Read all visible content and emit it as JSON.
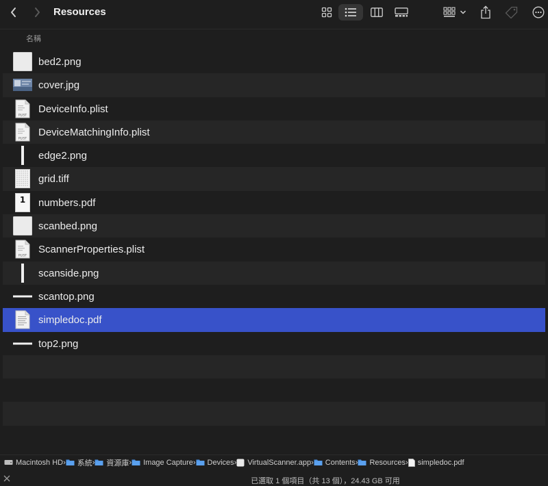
{
  "toolbar": {
    "title": "Resources"
  },
  "list_header": {
    "name_column": "名稱"
  },
  "files": [
    {
      "name": "bed2.png",
      "thumb": "blank-image"
    },
    {
      "name": "cover.jpg",
      "thumb": "photo"
    },
    {
      "name": "DeviceInfo.plist",
      "thumb": "plist"
    },
    {
      "name": "DeviceMatchingInfo.plist",
      "thumb": "plist"
    },
    {
      "name": "edge2.png",
      "thumb": "vertical-strip"
    },
    {
      "name": "grid.tiff",
      "thumb": "grid"
    },
    {
      "name": "numbers.pdf",
      "thumb": "numbered-page"
    },
    {
      "name": "scanbed.png",
      "thumb": "blank-image"
    },
    {
      "name": "ScannerProperties.plist",
      "thumb": "plist"
    },
    {
      "name": "scanside.png",
      "thumb": "vertical-strip"
    },
    {
      "name": "scantop.png",
      "thumb": "horizontal-strip"
    },
    {
      "name": "simpledoc.pdf",
      "thumb": "document",
      "selected": true
    },
    {
      "name": "top2.png",
      "thumb": "horizontal-strip"
    }
  ],
  "plist_thumb_label": "PLIST",
  "numbers_thumb_label": "1",
  "pathbar": [
    {
      "label": "Macintosh HD",
      "icon": "disk-icon"
    },
    {
      "label": "系統",
      "icon": "folder-icon"
    },
    {
      "label": "資源庫",
      "icon": "folder-icon"
    },
    {
      "label": "Image Capture",
      "icon": "folder-icon"
    },
    {
      "label": "Devices",
      "icon": "folder-icon"
    },
    {
      "label": "VirtualScanner.app",
      "icon": "app-icon"
    },
    {
      "label": "Contents",
      "icon": "folder-icon"
    },
    {
      "label": "Resources",
      "icon": "folder-icon"
    },
    {
      "label": "simpledoc.pdf",
      "icon": "document-icon"
    }
  ],
  "status": {
    "text": "已選取 1 個項目（共 13 個），24.43 GB 可用"
  },
  "colors": {
    "selection": "#3852c9",
    "folder": "#4a8fe0",
    "background": "#1e1e1e",
    "alt_row": "#262626"
  }
}
